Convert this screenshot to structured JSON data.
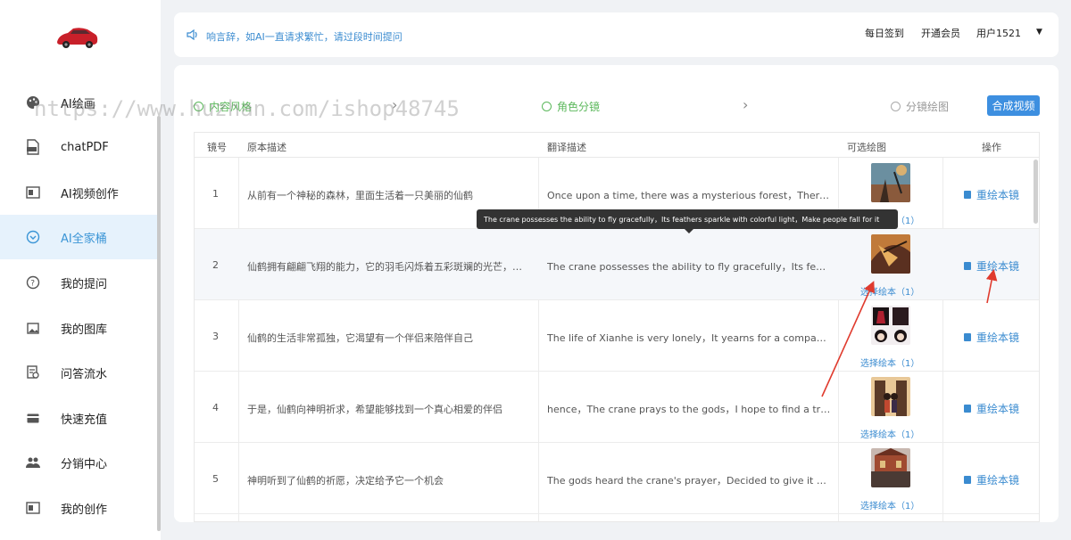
{
  "sidebar": {
    "items": [
      {
        "label": "AI绘画",
        "icon": "paint-palette-icon"
      },
      {
        "label": "chatPDF",
        "icon": "pdf-file-icon"
      },
      {
        "label": "AI视频创作",
        "icon": "video-icon"
      },
      {
        "label": "AI全家桶",
        "icon": "ai-bundle-icon",
        "active": true
      },
      {
        "label": "我的提问",
        "icon": "question-icon"
      },
      {
        "label": "我的图库",
        "icon": "gallery-icon"
      },
      {
        "label": "问答流水",
        "icon": "record-icon"
      },
      {
        "label": "快速充值",
        "icon": "card-icon"
      },
      {
        "label": "分销中心",
        "icon": "users-icon"
      },
      {
        "label": "我的创作",
        "icon": "creation-icon"
      }
    ]
  },
  "header": {
    "notice": "响言辞，如AI一直请求繁忙，请过段时间提问",
    "checkin": "每日签到",
    "vip": "开通会员",
    "user": "用户1521"
  },
  "steps": [
    {
      "label": "内容风格",
      "state": "done"
    },
    {
      "label": "角色分镜",
      "state": "active"
    },
    {
      "label": "分镜绘图",
      "state": "pending"
    }
  ],
  "compose_button": "合成视频",
  "table": {
    "headers": [
      "镜号",
      "原本描述",
      "翻译描述",
      "可选绘图",
      "操作"
    ],
    "rows": [
      {
        "no": "1",
        "orig": "从前有一个神秘的森林，里面生活着一只美丽的仙鹤",
        "trans": "Once upon a time, there was a mysterious forest，There lives a ...",
        "pick": "选择绘本（1）",
        "action": "重绘本镜"
      },
      {
        "no": "2",
        "orig": "仙鹤拥有翩翩飞翔的能力，它的羽毛闪烁着五彩斑斓的光芒，让人们...",
        "trans": "The crane possesses the ability to fly gracefully，Its feathers sp...",
        "pick": "选择绘本（1）",
        "action": "重绘本镜"
      },
      {
        "no": "3",
        "orig": "仙鹤的生活非常孤独，它渴望有一个伴侣来陪伴自己",
        "trans": "The life of Xianhe is very lonely，It yearns for a companion to a...",
        "pick": "选择绘本（1）",
        "action": "重绘本镜"
      },
      {
        "no": "4",
        "orig": "于是，仙鹤向神明祈求，希望能够找到一个真心相爱的伴侣",
        "trans": "hence，The crane prays to the gods，I hope to find a true and l...",
        "pick": "选择绘本（1）",
        "action": "重绘本镜"
      },
      {
        "no": "5",
        "orig": "神明听到了仙鹤的祈愿，决定给予它一个机会",
        "trans": "The gods heard the crane's prayer，Decided to give it a chance",
        "pick": "选择绘本（1）",
        "action": "重绘本镜"
      }
    ]
  },
  "tooltip": "The crane possesses the ability to fly gracefully，Its feathers sparkle with colorful light，Make people fall for it",
  "watermark": "https://www.huzhan.com/ishop48745",
  "colors": {
    "accent": "#3a8bd0",
    "active_bg": "#e6f2fc",
    "step_green": "#5cb85c",
    "arrow_red": "#e03b2e"
  }
}
